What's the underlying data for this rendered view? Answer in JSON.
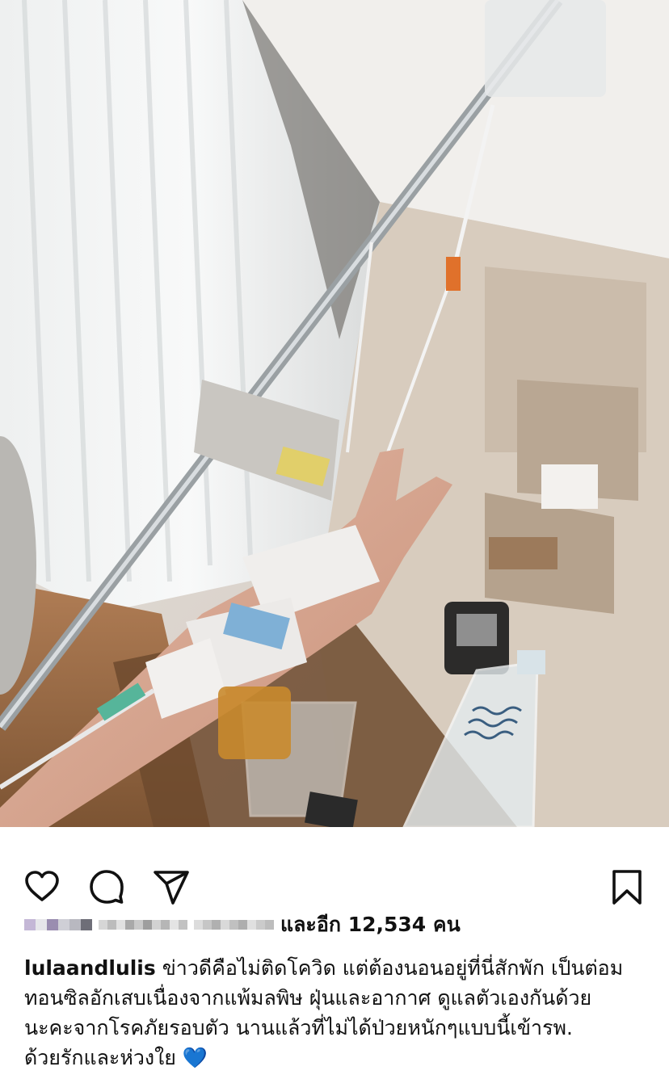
{
  "post": {
    "photo_alt": "Hospital room with IV drip stand and hand making a peace sign",
    "actions": {
      "like": "heart-icon",
      "comment": "comment-icon",
      "share": "send-icon",
      "save": "bookmark-icon"
    },
    "likes": {
      "text": "และอีก 12,534 คน"
    },
    "caption": {
      "username": "lulaandlulis",
      "line1": "ข่าวดีคือไม่ติดโควิด แต่ต้องนอนอยู่ที่นี่สักพัก เป็นต่อม",
      "line2": "ทอนซิลอักเสบเนื่องจากแพ้มลพิษ ฝุ่นและอากาศ ดูแลตัวเองกันด้วย",
      "line3": "นะคะจากโรคภัยรอบตัว นานแล้วที่ไม่ได้ป่วยหนักๆแบบนี้เข้ารพ.",
      "line4": "ด้วยรักและห่วงใย",
      "emoji": "💙"
    }
  }
}
